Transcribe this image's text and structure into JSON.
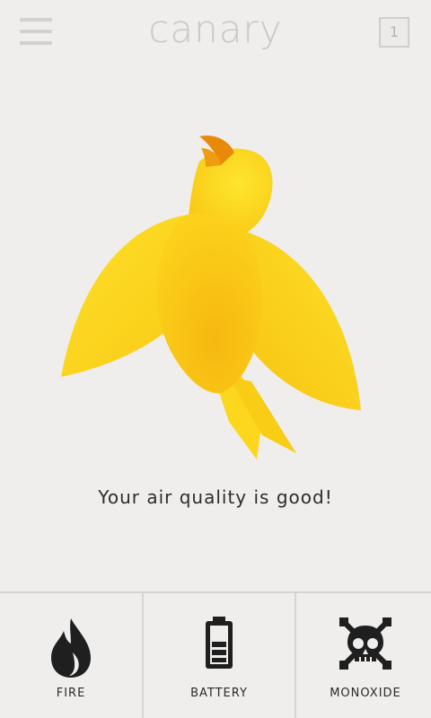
{
  "header": {
    "app_name": "canary",
    "notification_count": "1",
    "menu_icon": "hamburger-menu-icon"
  },
  "main": {
    "mascot": "canary-bird",
    "status_text": "Your air quality is good!"
  },
  "bottom_tabs": [
    {
      "label": "FIRE",
      "icon": "flame-icon"
    },
    {
      "label": "BATTERY",
      "icon": "battery-icon"
    },
    {
      "label": "MONOXIDE",
      "icon": "skull-crossbones-icon"
    }
  ],
  "colors": {
    "background": "#efeeec",
    "bird_yellow": "#fcd21c",
    "beak_orange": "#e9890a",
    "icon_dark": "#1f1f1f"
  }
}
